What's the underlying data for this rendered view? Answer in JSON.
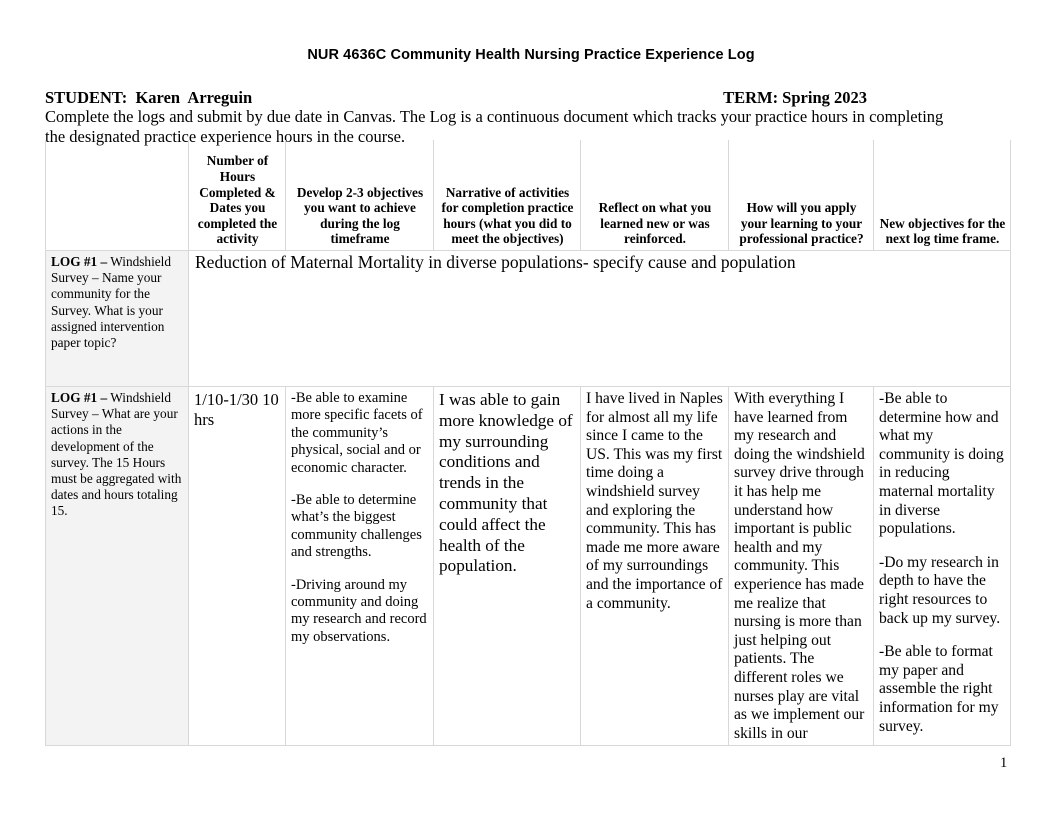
{
  "document": {
    "title": "NUR 4636C Community Health Nursing Practice Experience Log",
    "student_label": "STUDENT:  Karen  Arreguin",
    "term_label": "TERM: Spring 2023",
    "instructions": "Complete the logs and submit by due date in Canvas. The Log is a continuous document which tracks your practice hours in completing the designated practice experience hours in the course.",
    "page_number": "1"
  },
  "table": {
    "headers": {
      "col1": "",
      "col2": "Number of Hours Completed & Dates you completed the activity",
      "col3": "Develop 2-3 objectives you want to achieve during the log timeframe",
      "col4": "Narrative of activities for completion practice hours (what you did to meet the objectives)",
      "col5": "Reflect on what you learned new or was reinforced.",
      "col6": "How will you apply your learning to your professional practice?",
      "col7": "New objectives for the next log time frame."
    },
    "rows": [
      {
        "label_bold": "LOG #1 –",
        "label_rest": " Windshield Survey –  Name your community for the Survey.  What is your assigned intervention paper topic?",
        "span_text": "Reduction of Maternal Mortality in diverse populations- specify cause and population"
      },
      {
        "label_bold": "LOG #1 –",
        "label_rest": " Windshield Survey –   What are your actions in the development of the survey. The 15 Hours must be aggregated with dates and hours totaling 15.",
        "hours": "1/10-1/30 10 hrs",
        "objectives": [
          "-Be able to examine more specific facets of the community’s physical, social and or economic character.",
          "-Be able to determine what’s the biggest community challenges and strengths.",
          "-Driving around my community and doing my research and record my observations."
        ],
        "narrative": "I was able to gain more knowledge of my surrounding conditions and trends in the community that could affect the health of the population.",
        "reflection": "I have lived in Naples for almost all my life since I came to the US. This was my first time doing a windshield survey and exploring the community. This has made me more aware of my surroundings and the importance of a community.",
        "application": "With everything I have learned from my research and doing the windshield survey drive through it has help me understand how important is public health and my community. This experience has made me realize that nursing is more than just helping out patients. The different roles we nurses play are vital as we implement our skills in our",
        "new_objectives": [
          "-Be able to determine how and what my community is doing in reducing maternal mortality in diverse populations.",
          "-Do my research in depth to have the right resources to back up my survey.",
          "-Be able to format my paper and assemble the right information for my survey."
        ]
      }
    ]
  }
}
